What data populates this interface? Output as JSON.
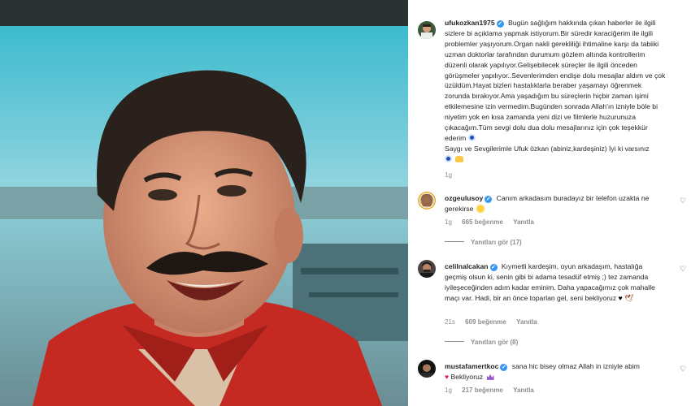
{
  "post": {
    "author": "ufukozkan1975",
    "caption": "Bugün sağlığım hakkında çıkan haberler ile ilgili sizlere bi açıklama yapmak istiyorum.Bir süredir karaciğerim ile ilgili problemler yaşıyorum.Organ nakli gerekliliği ihtimaline karşı da tabiiki uzman doktorlar tarafından durumum gözlem altında kontrollerim düzenli olarak yapılıyor.Gelişebilecek süreçler ile ilgili önceden görüşmeler yapılıyor..Sevenlerimden endişe dolu mesajlar aldım ve çok üzüldüm.Hayat bizleri hastalıklarla beraber yaşamayı öğrenmek zorunda bırakıyor.Ama yaşadığım bu süreçlerin hiçbir zaman işimi etkilemesine izin vermedim.Bugünden sonrada Allah'ın izniyle böle bi niyetim yok en kısa zamanda yeni dizi ve filmlerle huzurunuza çıkacağım.Tüm sevgi dolu dua dolu mesajlarınız için çok teşekkür ederim",
    "caption_line2": "Saygı ve Sevgilerimle Ufuk özkan (abiniz,kardeşiniz) İyi ki varsınız",
    "time": "1g"
  },
  "comments": [
    {
      "author": "ozgeulusoy",
      "text": "Canım arkadasım buradayız bir telefon uzakta ne gerekirse",
      "time": "1g",
      "likes": "665 beğenme",
      "reply": "Yanıtla",
      "view_replies": "Yanıtları gör (17)"
    },
    {
      "author": "celilnalcakan",
      "text": "Kıymetli kardeşim, oyun arkadaşım, hastalığa geçmiş olsun ki, senin gibi bi adama tesadüf etmiş ;) tez zamanda iyileşeceğinden adım kadar eminim. Daha yapacağımız çok mahalle maçı var. Hadi, bir an önce toparlan gel, seni bekliyoruz",
      "time": "21s",
      "likes": "609 beğenme",
      "reply": "Yanıtla",
      "view_replies": "Yanıtları gör (8)"
    },
    {
      "author": "mustafamertkoc",
      "text": "sana hic bisey olmaz Allah in izniyle abim",
      "text2": "Bekliyoruz",
      "time": "1g",
      "likes": "217 beğenme",
      "reply": "Yanıtla"
    }
  ],
  "icons": {
    "verified": "✓",
    "like": "♡",
    "heart_black": "♥",
    "heart_red": "♥",
    "bird": "🕊"
  },
  "colors": {
    "verified_blue": "#3897f0",
    "muted": "#8e8e8e",
    "text": "#262626"
  }
}
